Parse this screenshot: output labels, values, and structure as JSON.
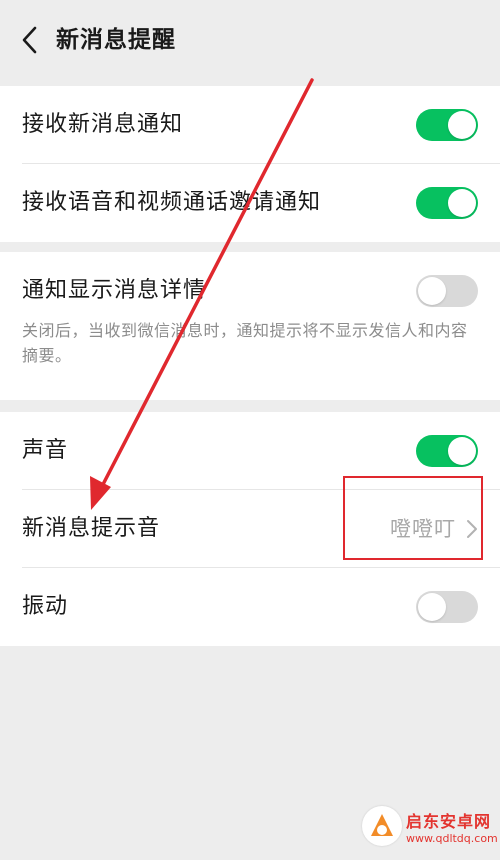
{
  "header": {
    "title": "新消息提醒",
    "back_icon": "chevron-left-icon"
  },
  "groups": [
    {
      "rows": [
        {
          "label": "接收新消息通知",
          "toggle": true
        },
        {
          "label": "接收语音和视频通话邀请通知",
          "toggle": true
        }
      ]
    },
    {
      "rows": [
        {
          "label": "通知显示消息详情",
          "toggle": false,
          "description": "关闭后，当收到微信消息时，通知提示将不显示发信人和内容摘要。"
        }
      ]
    },
    {
      "rows": [
        {
          "label": "声音",
          "toggle": true
        },
        {
          "label": "新消息提示音",
          "value": "噔噔叮"
        },
        {
          "label": "振动",
          "toggle": false
        }
      ]
    }
  ],
  "annotation": {
    "arrow_color": "#e0282e",
    "box_color": "#e0282e"
  },
  "watermark": {
    "name": "启东安卓网",
    "url": "www.qdltdq.com"
  },
  "colors": {
    "toggle_on": "#07c160",
    "toggle_off": "#d9d9d9",
    "background": "#ededed"
  }
}
